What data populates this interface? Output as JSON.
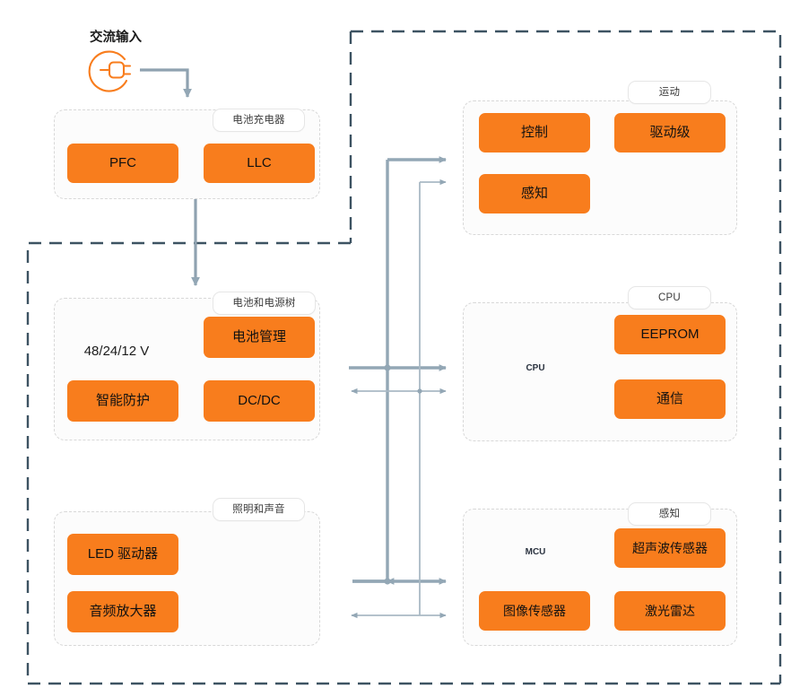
{
  "diagram": {
    "title_ac_input": "交流输入",
    "battery_voltage_caption": "48/24/12 V",
    "colors": {
      "accent_orange": "#F87D1D",
      "outer_dashed_border": "#3D5362",
      "group_dashed_border": "#D8D8D8",
      "bus_line": "#93A7B5",
      "icon_outline_slate": "#4E5B6E",
      "icon_outline_grey": "#B3BEC8",
      "group_fill": "#FCFCFC"
    },
    "groups": [
      {
        "id": "battery-charger",
        "label": "电池充电器",
        "blocks": [
          "PFC",
          "LLC"
        ]
      },
      {
        "id": "battery-and-power-tree",
        "label": "电池和电源树",
        "blocks": [
          "电池管理",
          "智能防护",
          "DC/DC"
        ],
        "icons": [
          "battery-icon"
        ]
      },
      {
        "id": "lighting-and-sound",
        "label": "照明和声音",
        "blocks": [
          "LED 驱动器",
          "音频放大器"
        ],
        "icons": [
          "led-icon",
          "speaker-icon"
        ]
      },
      {
        "id": "motion",
        "label": "运动",
        "blocks": [
          "控制",
          "驱动级",
          "感知"
        ],
        "icons": [
          "motor-icon"
        ]
      },
      {
        "id": "cpu",
        "label": "CPU",
        "blocks": [
          "EEPROM",
          "通信"
        ],
        "icons": [
          "cpu-chip-icon"
        ],
        "chip_text": "CPU"
      },
      {
        "id": "sensing",
        "label": "感知",
        "blocks": [
          "超声波传感器",
          "图像传感器",
          "激光雷达"
        ],
        "icons": [
          "mcu-chip-icon"
        ],
        "chip_text": "MCU"
      }
    ],
    "blocks": {
      "pfc": "PFC",
      "llc": "LLC",
      "battery_management": "电池管理",
      "smart_protection": "智能防护",
      "dcdc": "DC/DC",
      "led_driver": "LED 驱动器",
      "audio_amp": "音频放大器",
      "control": "控制",
      "drive_stage": "驱动级",
      "motion_sense": "感知",
      "eeprom": "EEPROM",
      "communication": "通信",
      "ultrasonic_sensor": "超声波传感器",
      "image_sensor": "图像传感器",
      "lidar": "激光雷达"
    },
    "labels": {
      "battery_charger": "电池充电器",
      "battery_power_tree": "电池和电源树",
      "lighting_sound": "照明和声音",
      "motion": "运动",
      "cpu": "CPU",
      "sensing": "感知"
    },
    "chip_labels": {
      "cpu": "CPU",
      "mcu": "MCU"
    }
  }
}
